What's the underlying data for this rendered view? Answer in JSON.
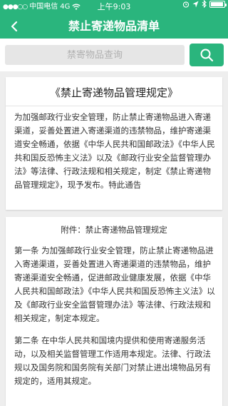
{
  "status_bar": {
    "carrier": "中国电信",
    "network": "4G",
    "time": "上午9:03"
  },
  "nav": {
    "title": "禁止寄递物品清单"
  },
  "search": {
    "placeholder": "禁寄物品查询"
  },
  "notice": {
    "title": "《禁止寄递物品管理规定》",
    "body": "为加强邮政行业安全管理，防止禁止寄递物品进入寄递渠道，妥善处置进入寄递渠道的违禁物品，维护寄递渠道安全畅通，依据《中华人民共和国邮政法》《中华人民共和国反恐怖主义法》以及《邮政行业安全监督管理办法》等法律、行政法规和相关规定，制定《禁止寄递物品管理规定》，现予发布。特此通告"
  },
  "attachment": {
    "title": "附件：禁止寄递物品管理规定",
    "paragraphs": [
      "第一条    为加强邮政行业安全管理，防止禁止寄递物品进入寄递渠道，妥善处置进入寄递渠道的违禁物品，维护寄递渠道安全畅通，促进邮政业健康发展，依据《中华人民共和国邮政法》《中华人民共和国反恐怖主义法》以及《邮政行业安全监督管理办法》等法律、行政法规和相关规定，制定本规定。",
      "第二条    在中华人民共和国境内提供和使用寄递服务活动，以及相关监督管理工作适用本规定。法律、行政法规以及国务院和国务院有关部门对禁止进出境物品另有规定的，适用其规定。"
    ]
  }
}
